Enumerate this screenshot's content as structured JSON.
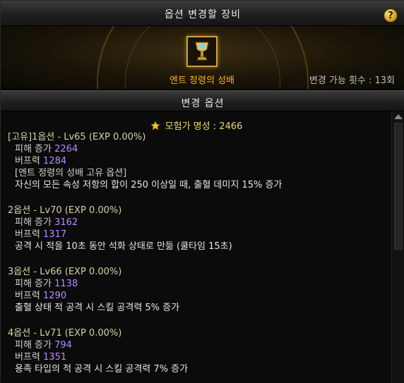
{
  "window": {
    "title": "옵션 변경할 장비",
    "help": "?"
  },
  "item": {
    "name": "엔트 정령의 성배",
    "icon": "holy-grail-icon",
    "change_count_label": "변경 가능 횟수 : 13회"
  },
  "section": {
    "title": "변경 옵션"
  },
  "fame": {
    "text": "모험가 명성 : 2466",
    "icon": "fame-medal-icon"
  },
  "options": [
    {
      "header": "[고유]1옵션 - Lv65 (EXP 0.00%)",
      "damage_label": "피해 증가",
      "damage_value": "2264",
      "buff_label": "버프력",
      "buff_value": "1284",
      "note": "[엔트 정령의 성배 고유 옵션]",
      "desc": "자신의 모든 속성 저항의 합이 250 이상일 때, 출혈 데미지 15% 증가"
    },
    {
      "header": "2옵션 - Lv70 (EXP 0.00%)",
      "damage_label": "피해 증가",
      "damage_value": "3162",
      "buff_label": "버프력",
      "buff_value": "1317",
      "desc": "공격 시 적을 10초 동안 석화 상태로 만듦 (쿨타임 15초)"
    },
    {
      "header": "3옵션 - Lv66 (EXP 0.00%)",
      "damage_label": "피해 증가",
      "damage_value": "1138",
      "buff_label": "버프력",
      "buff_value": "1290",
      "desc": "출혈 상태 적 공격 시 스킬 공격력 5% 증가"
    },
    {
      "header": "4옵션 - Lv71 (EXP 0.00%)",
      "damage_label": "피해 증가",
      "damage_value": "794",
      "buff_label": "버프력",
      "buff_value": "1351",
      "desc": "용족 타입의 적 공격 시 스킬 공격력 7% 증가"
    }
  ],
  "colors": {
    "value": "#b48cff",
    "item_name": "#ffb030",
    "fame": "#f0d870"
  }
}
